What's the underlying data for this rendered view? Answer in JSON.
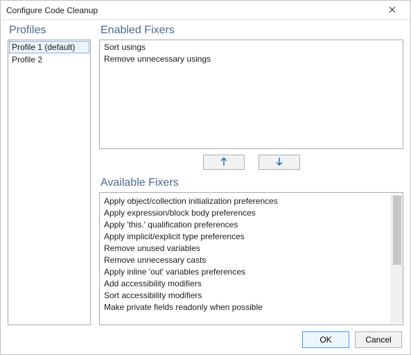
{
  "window": {
    "title": "Configure Code Cleanup"
  },
  "labels": {
    "profiles": "Profiles",
    "enabled": "Enabled Fixers",
    "available": "Available Fixers"
  },
  "profiles": {
    "items": [
      {
        "label": "Profile 1 (default)",
        "selected": true
      },
      {
        "label": "Profile 2",
        "selected": false
      }
    ]
  },
  "enabled_fixers": [
    "Sort usings",
    "Remove unnecessary usings"
  ],
  "available_fixers": [
    "Apply object/collection initialization preferences",
    "Apply expression/block body preferences",
    "Apply 'this.' qualification preferences",
    "Apply implicit/explicit type preferences",
    "Remove unused variables",
    "Remove unnecessary casts",
    "Apply inline 'out' variables preferences",
    "Add accessibility modifiers",
    "Sort accessibility modifiers",
    "Make private fields readonly when possible"
  ],
  "buttons": {
    "ok": "OK",
    "cancel": "Cancel"
  },
  "colors": {
    "heading": "#4a6a8a",
    "selection": "#eaf3fb",
    "arrow": "#0066cc"
  }
}
